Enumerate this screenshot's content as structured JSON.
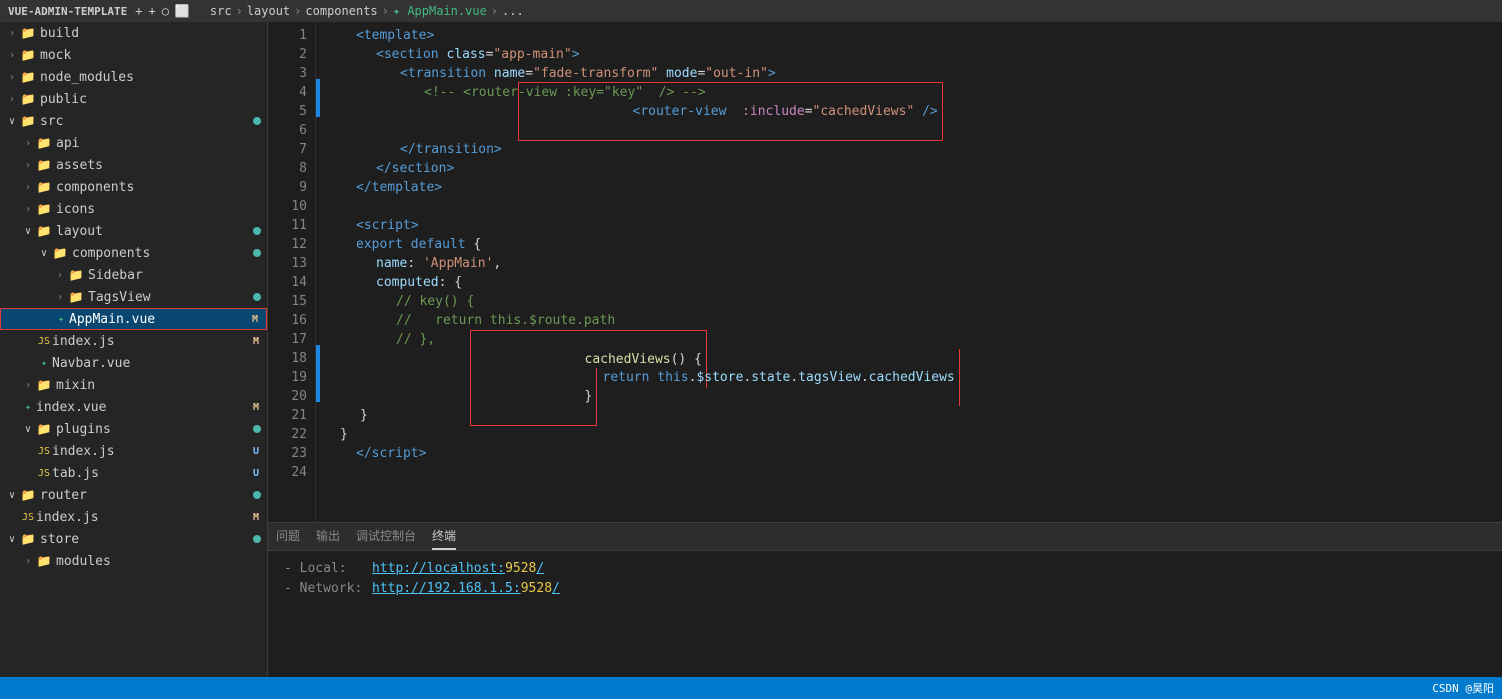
{
  "topbar": {
    "title": "VUE-ADMIN-TEMPLATE",
    "icons": [
      "+",
      "+",
      "○",
      "⬜"
    ],
    "breadcrumb": [
      "src",
      "layout",
      "components",
      "AppMain.vue",
      "..."
    ]
  },
  "sidebar": {
    "items": [
      {
        "id": "build",
        "label": "build",
        "type": "folder",
        "indent": 0,
        "expanded": false
      },
      {
        "id": "mock",
        "label": "mock",
        "type": "folder",
        "indent": 0,
        "expanded": false
      },
      {
        "id": "node_modules",
        "label": "node_modules",
        "type": "folder",
        "indent": 0,
        "expanded": false
      },
      {
        "id": "public",
        "label": "public",
        "type": "folder",
        "indent": 0,
        "expanded": false
      },
      {
        "id": "src",
        "label": "src",
        "type": "folder",
        "indent": 0,
        "expanded": true,
        "dot": true
      },
      {
        "id": "api",
        "label": "api",
        "type": "folder",
        "indent": 1,
        "expanded": false
      },
      {
        "id": "assets",
        "label": "assets",
        "type": "folder",
        "indent": 1,
        "expanded": false
      },
      {
        "id": "components",
        "label": "components",
        "type": "folder",
        "indent": 1,
        "expanded": false
      },
      {
        "id": "icons",
        "label": "icons",
        "type": "folder",
        "indent": 1,
        "expanded": false
      },
      {
        "id": "layout",
        "label": "layout",
        "type": "folder",
        "indent": 1,
        "expanded": true,
        "dot": true
      },
      {
        "id": "layout-components",
        "label": "components",
        "type": "folder",
        "indent": 2,
        "expanded": true,
        "dot": true
      },
      {
        "id": "sidebar",
        "label": "Sidebar",
        "type": "folder",
        "indent": 3,
        "expanded": false
      },
      {
        "id": "tagsview",
        "label": "TagsView",
        "type": "folder",
        "indent": 3,
        "expanded": false,
        "dot": true
      },
      {
        "id": "appmain",
        "label": "AppMain.vue",
        "type": "vue",
        "indent": 3,
        "selected": true,
        "badge": "M"
      },
      {
        "id": "indexjs-layout",
        "label": "index.js",
        "type": "js",
        "indent": 2,
        "badge": "M"
      },
      {
        "id": "navbar",
        "label": "Navbar.vue",
        "type": "vue",
        "indent": 2
      },
      {
        "id": "mixin",
        "label": "mixin",
        "type": "folder",
        "indent": 1,
        "expanded": false
      },
      {
        "id": "indexvue",
        "label": "index.vue",
        "type": "vue",
        "indent": 1,
        "badge": "M"
      },
      {
        "id": "plugins",
        "label": "plugins",
        "type": "folder",
        "indent": 1,
        "expanded": true,
        "dot": true
      },
      {
        "id": "plugins-indexjs",
        "label": "index.js",
        "type": "js",
        "indent": 2,
        "badge": "U"
      },
      {
        "id": "plugins-tabjs",
        "label": "tab.js",
        "type": "js",
        "indent": 2,
        "badge": "U"
      },
      {
        "id": "router",
        "label": "router",
        "type": "folder",
        "indent": 0,
        "expanded": true,
        "dot": true
      },
      {
        "id": "router-indexjs",
        "label": "index.js",
        "type": "js",
        "indent": 1,
        "badge": "M"
      },
      {
        "id": "store",
        "label": "store",
        "type": "folder",
        "indent": 0,
        "expanded": true,
        "dot": true
      },
      {
        "id": "modules",
        "label": "modules",
        "type": "folder",
        "indent": 1,
        "expanded": false
      }
    ]
  },
  "editor": {
    "lines": [
      {
        "num": 1,
        "indent": 2,
        "tokens": [
          {
            "text": "<template>",
            "cls": "kw"
          }
        ],
        "indicator": false
      },
      {
        "num": 2,
        "indent": 4,
        "tokens": [
          {
            "text": "<section ",
            "cls": "kw"
          },
          {
            "text": "class",
            "cls": "attr"
          },
          {
            "text": "=",
            "cls": "white"
          },
          {
            "text": "\"app-main\"",
            "cls": "str"
          },
          {
            "text": ">",
            "cls": "kw"
          }
        ],
        "indicator": false
      },
      {
        "num": 3,
        "indent": 6,
        "tokens": [
          {
            "text": "<transition ",
            "cls": "kw"
          },
          {
            "text": "name",
            "cls": "attr"
          },
          {
            "text": "=",
            "cls": "white"
          },
          {
            "text": "\"fade-transform\"",
            "cls": "str"
          },
          {
            "text": " ",
            "cls": "white"
          },
          {
            "text": "mode",
            "cls": "attr"
          },
          {
            "text": "=",
            "cls": "white"
          },
          {
            "text": "\"out-in\"",
            "cls": "str"
          },
          {
            "text": ">",
            "cls": "kw"
          }
        ],
        "indicator": false
      },
      {
        "num": 4,
        "indent": 8,
        "tokens": [
          {
            "text": "<!-- ",
            "cls": "cmt"
          },
          {
            "text": "<router-view :key=\"key\"  /> ",
            "cls": "cmt"
          },
          {
            "text": "-->",
            "cls": "cmt"
          }
        ],
        "indicator": true
      },
      {
        "num": 5,
        "indent": 8,
        "tokens": [
          {
            "text": "<router-view  :include",
            "cls": "kw",
            "isattr": true
          },
          {
            "text": "=",
            "cls": "white"
          },
          {
            "text": "\"cachedViews\"",
            "cls": "str"
          },
          {
            "text": " />",
            "cls": "kw"
          }
        ],
        "indicator": true,
        "highlight": true
      },
      {
        "num": 6,
        "indent": 0,
        "tokens": [],
        "indicator": false
      },
      {
        "num": 7,
        "indent": 6,
        "tokens": [
          {
            "text": "</transition>",
            "cls": "kw"
          }
        ],
        "indicator": false
      },
      {
        "num": 8,
        "indent": 4,
        "tokens": [
          {
            "text": "</section>",
            "cls": "kw"
          }
        ],
        "indicator": false
      },
      {
        "num": 9,
        "indent": 2,
        "tokens": [
          {
            "text": "</template>",
            "cls": "kw"
          }
        ],
        "indicator": false
      },
      {
        "num": 10,
        "indent": 0,
        "tokens": [],
        "indicator": false
      },
      {
        "num": 11,
        "indent": 2,
        "tokens": [
          {
            "text": "<script>",
            "cls": "kw"
          }
        ],
        "indicator": false
      },
      {
        "num": 12,
        "indent": 2,
        "tokens": [
          {
            "text": "export ",
            "cls": "blue-kw"
          },
          {
            "text": "default",
            "cls": "blue-kw"
          },
          {
            "text": " {",
            "cls": "white"
          }
        ],
        "indicator": false
      },
      {
        "num": 13,
        "indent": 4,
        "tokens": [
          {
            "text": "name",
            "cls": "prop"
          },
          {
            "text": ": ",
            "cls": "white"
          },
          {
            "text": "'AppMain'",
            "cls": "str"
          },
          {
            "text": ",",
            "cls": "white"
          }
        ],
        "indicator": false
      },
      {
        "num": 14,
        "indent": 4,
        "tokens": [
          {
            "text": "computed",
            "cls": "prop"
          },
          {
            "text": ": {",
            "cls": "white"
          }
        ],
        "indicator": false
      },
      {
        "num": 15,
        "indent": 6,
        "tokens": [
          {
            "text": "// key() {",
            "cls": "cmt"
          }
        ],
        "indicator": false
      },
      {
        "num": 16,
        "indent": 6,
        "tokens": [
          {
            "text": "//   return this.$route.path",
            "cls": "cmt"
          }
        ],
        "indicator": false
      },
      {
        "num": 17,
        "indent": 6,
        "tokens": [
          {
            "text": "// },",
            "cls": "cmt"
          }
        ],
        "indicator": false
      },
      {
        "num": 18,
        "indent": 4,
        "tokens": [
          {
            "text": "cachedViews",
            "cls": "fn"
          },
          {
            "text": "() {",
            "cls": "white"
          }
        ],
        "indicator": true,
        "highlightBox": true
      },
      {
        "num": 19,
        "indent": 6,
        "tokens": [
          {
            "text": "return ",
            "cls": "blue-kw"
          },
          {
            "text": "this",
            "cls": "blue-kw"
          },
          {
            "text": ".",
            "cls": "white"
          },
          {
            "text": "$store",
            "cls": "prop"
          },
          {
            "text": ".",
            "cls": "white"
          },
          {
            "text": "state",
            "cls": "prop"
          },
          {
            "text": ".",
            "cls": "white"
          },
          {
            "text": "tagsView",
            "cls": "prop"
          },
          {
            "text": ".",
            "cls": "white"
          },
          {
            "text": "cachedViews",
            "cls": "prop"
          }
        ],
        "indicator": true,
        "highlightBox": true
      },
      {
        "num": 20,
        "indent": 4,
        "tokens": [
          {
            "text": "}",
            "cls": "white"
          }
        ],
        "indicator": true,
        "highlightBox": true
      },
      {
        "num": 21,
        "indent": 2,
        "tokens": [
          {
            "text": "}",
            "cls": "white"
          }
        ],
        "indicator": false
      },
      {
        "num": 22,
        "indent": 0,
        "tokens": [
          {
            "text": "}",
            "cls": "white"
          }
        ],
        "indicator": false
      },
      {
        "num": 23,
        "indent": 2,
        "tokens": [
          {
            "text": "</",
            "cls": "kw"
          },
          {
            "text": "script",
            "cls": "kw"
          },
          {
            "text": ">",
            "cls": "kw"
          }
        ],
        "indicator": false
      },
      {
        "num": 24,
        "indent": 0,
        "tokens": [],
        "indicator": false
      }
    ]
  },
  "bottomPanel": {
    "tabs": [
      "问题",
      "输出",
      "调试控制台",
      "终端"
    ],
    "activeTab": "终端",
    "terminal": [
      {
        "label": "- Local:",
        "value": "http://localhost:",
        "port": "9528",
        "suffix": "/"
      },
      {
        "label": "- Network:",
        "value": "http://192.168.1.5:",
        "port": "9528",
        "suffix": "/"
      }
    ]
  },
  "statusBar": {
    "right": "CSDN @昊阳"
  }
}
